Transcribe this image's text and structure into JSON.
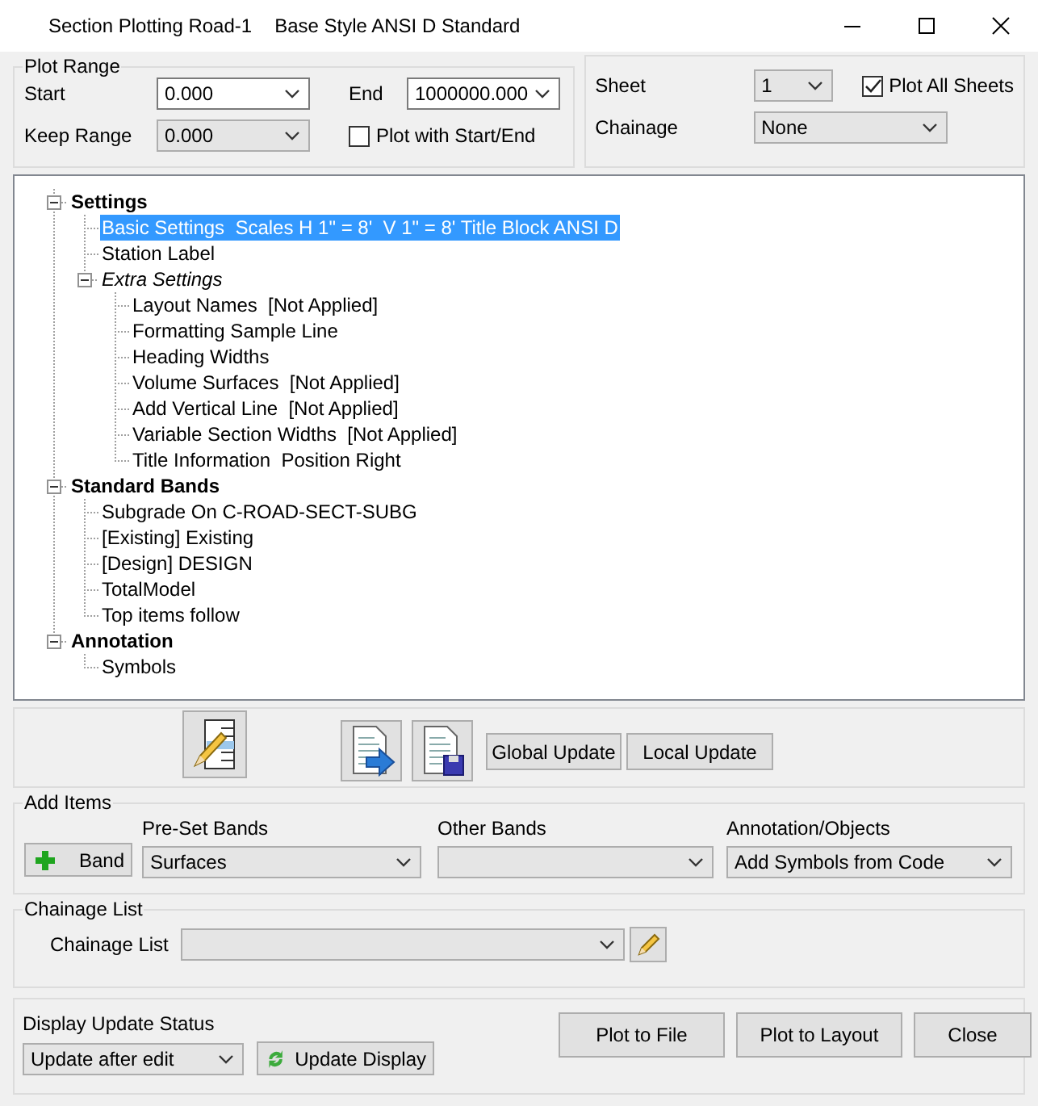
{
  "window": {
    "title": "Section Plotting Road-1",
    "style_name": "Base Style ANSI D Standard"
  },
  "plot_range": {
    "title": "Plot Range",
    "start": {
      "label": "Start",
      "value": "0.000",
      "kind": "edit"
    },
    "end": {
      "label": "End",
      "value": "1000000.000",
      "kind": "edit"
    },
    "keep_range": {
      "label": "Keep Range",
      "value": "0.000",
      "kind": "list"
    },
    "plot_with_start_end": {
      "label": "Plot with Start/End",
      "checked": false
    }
  },
  "sheet_group": {
    "sheet": {
      "label": "Sheet",
      "value": "1",
      "kind": "list"
    },
    "plot_all_sheets": {
      "label": "Plot All Sheets",
      "checked": true
    },
    "chainage": {
      "label": "Chainage",
      "value": "None",
      "kind": "list"
    }
  },
  "tree": [
    {
      "label": "Settings",
      "kind": "section",
      "selected": false,
      "expanded": true,
      "children": [
        {
          "label": "Basic Settings  Scales H 1\" = 8'  V 1\" = 8' Title Block ANSI D",
          "kind": "item",
          "selected": true
        },
        {
          "label": "Station Label",
          "kind": "item",
          "selected": false
        },
        {
          "label": "Extra Settings",
          "kind": "subgroup",
          "selected": false,
          "expanded": true,
          "children": [
            {
              "label": "Layout Names  [Not Applied]",
              "kind": "item",
              "selected": false
            },
            {
              "label": "Formatting Sample Line",
              "kind": "item",
              "selected": false
            },
            {
              "label": "Heading Widths",
              "kind": "item",
              "selected": false
            },
            {
              "label": "Volume Surfaces  [Not Applied]",
              "kind": "item",
              "selected": false
            },
            {
              "label": "Add Vertical Line  [Not Applied]",
              "kind": "item",
              "selected": false
            },
            {
              "label": "Variable Section Widths  [Not Applied]",
              "kind": "item",
              "selected": false
            },
            {
              "label": "Title Information  Position Right",
              "kind": "item",
              "selected": false
            }
          ]
        }
      ]
    },
    {
      "label": "Standard Bands",
      "kind": "section",
      "selected": false,
      "expanded": true,
      "children": [
        {
          "label": "Subgrade On C-ROAD-SECT-SUBG",
          "kind": "item",
          "selected": false
        },
        {
          "label": "[Existing] Existing",
          "kind": "item",
          "selected": false
        },
        {
          "label": "[Design] DESIGN",
          "kind": "item",
          "selected": false
        },
        {
          "label": "TotalModel",
          "kind": "item",
          "selected": false
        },
        {
          "label": "Top items follow",
          "kind": "item",
          "selected": false
        }
      ]
    },
    {
      "label": "Annotation",
      "kind": "section",
      "selected": false,
      "expanded": true,
      "children": [
        {
          "label": "Symbols",
          "kind": "item",
          "selected": false
        }
      ]
    }
  ],
  "toolbar": {
    "global_update": "Global Update",
    "local_update": "Local Update"
  },
  "add_items": {
    "title": "Add Items",
    "band_button": "Band",
    "columns": [
      {
        "label": "Pre-Set Bands",
        "value": "Surfaces"
      },
      {
        "label": "Other Bands"
      },
      {
        "label": "Annotation/Objects",
        "value": "Add Symbols from Code"
      }
    ]
  },
  "chainage_list": {
    "title": "Chainage List",
    "label": "Chainage List"
  },
  "bottom": {
    "status_label": "Display Update Status",
    "status_value": "Update after edit",
    "update_display": "Update Display",
    "buttons": [
      "Plot to File",
      "Plot to Layout",
      "Close"
    ]
  }
}
